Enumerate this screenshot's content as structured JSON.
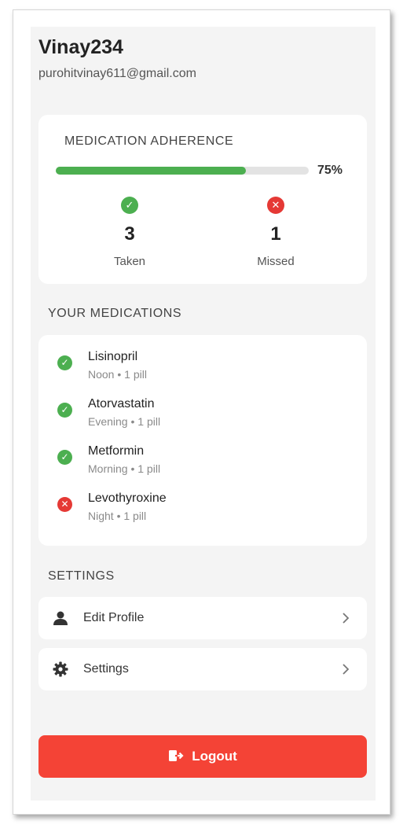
{
  "profile": {
    "username": "Vinay234",
    "email": "purohitvinay611@gmail.com"
  },
  "adherence": {
    "title": "MEDICATION ADHERENCE",
    "percent": 0.75,
    "percent_label": "75%",
    "taken": {
      "count": "3",
      "label": "Taken",
      "icon": "check-circle-icon"
    },
    "missed": {
      "count": "1",
      "label": "Missed",
      "icon": "x-circle-icon"
    }
  },
  "medications": {
    "title": "YOUR MEDICATIONS",
    "items": [
      {
        "name": "Lisinopril",
        "detail": "Noon • 1 pill",
        "status": "taken"
      },
      {
        "name": "Atorvastatin",
        "detail": "Evening • 1 pill",
        "status": "taken"
      },
      {
        "name": "Metformin",
        "detail": "Morning • 1 pill",
        "status": "taken"
      },
      {
        "name": "Levothyroxine",
        "detail": "Night • 1 pill",
        "status": "missed"
      }
    ]
  },
  "settings": {
    "title": "SETTINGS",
    "edit_profile": {
      "label": "Edit Profile",
      "icon": "person-icon"
    },
    "settings": {
      "label": "Settings",
      "icon": "gear-icon"
    }
  },
  "logout": {
    "label": "Logout",
    "icon": "logout-icon"
  },
  "colors": {
    "accent_green": "#4caf50",
    "danger_red": "#f44336",
    "background": "#f4f4f4"
  }
}
